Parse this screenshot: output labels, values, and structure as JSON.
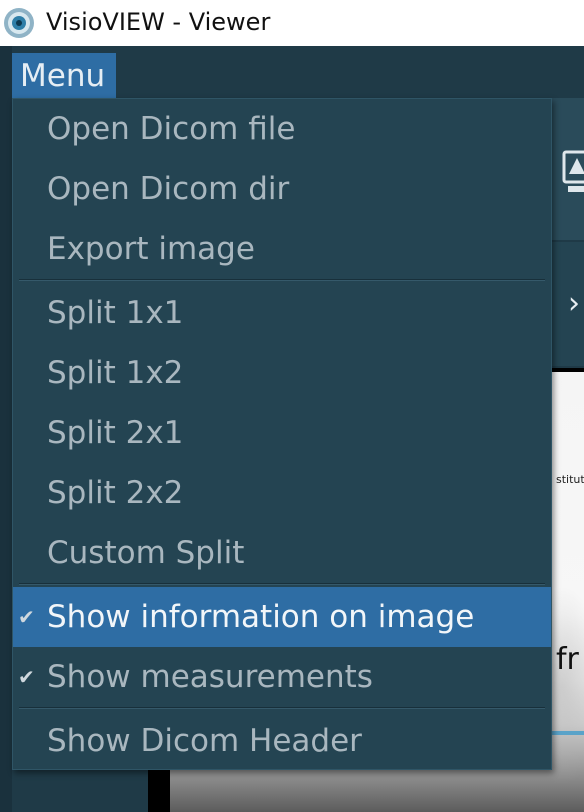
{
  "window": {
    "title": "VisioVIEW - Viewer",
    "logo_icon": "visioview-eye-logo"
  },
  "menubar": {
    "menu_label": "Menu"
  },
  "menu": {
    "file_items": [
      {
        "label": "Open Dicom file"
      },
      {
        "label": "Open Dicom dir"
      },
      {
        "label": "Export image"
      }
    ],
    "split_items": [
      {
        "label": "Split 1x1"
      },
      {
        "label": "Split 1x2"
      },
      {
        "label": "Split 2x1"
      },
      {
        "label": "Split 2x2"
      },
      {
        "label": "Custom Split"
      }
    ],
    "toggle_items": [
      {
        "label": "Show information on image",
        "checked": true,
        "highlighted": true
      },
      {
        "label": "Show measurements",
        "checked": true,
        "highlighted": false
      }
    ],
    "header_item": {
      "label": "Show Dicom Header"
    },
    "check_glyph": "✔"
  },
  "viewer": {
    "overlay_small_text": "stitutio",
    "overlay_large_text": "fr",
    "next_arrow": "›"
  },
  "colors": {
    "accent": "#2e6da4",
    "menu_bg": "#244452",
    "app_bg": "#1f3a47",
    "menu_text": "#a9b7bf"
  }
}
